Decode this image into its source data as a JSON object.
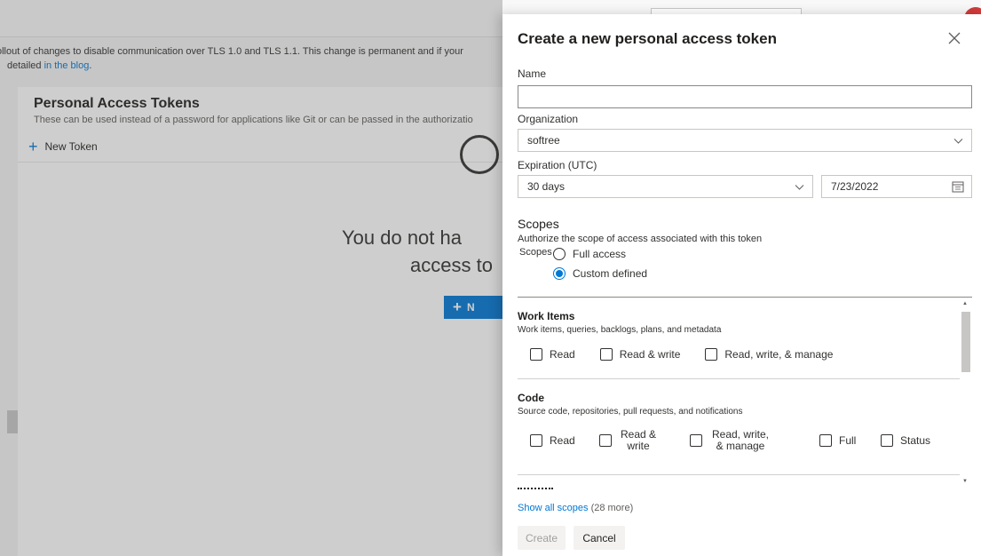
{
  "background": {
    "banner": {
      "line1": "ollout of changes to disable communication over TLS 1.0 and TLS 1.1. This change is permanent and if your",
      "line2_prefix": "detailed ",
      "line2_link": "in the blog",
      "line2_suffix": "."
    },
    "card": {
      "title": "Personal Access Tokens",
      "description": "These can be used instead of a password for applications like Git or can be passed in the authorizatio",
      "new_token_label": "New Token",
      "empty_line1": "You do not ha",
      "empty_line2": "access to",
      "new_button_label": "N"
    }
  },
  "panel": {
    "title": "Create a new personal access token",
    "name": {
      "label": "Name",
      "value": ""
    },
    "organization": {
      "label": "Organization",
      "selected": "softree"
    },
    "expiration": {
      "label": "Expiration (UTC)",
      "selected": "30 days",
      "date": "7/23/2022"
    },
    "scopes": {
      "title": "Scopes",
      "description": "Authorize the scope of access associated with this token",
      "radio_group_label": "Scopes",
      "options": [
        {
          "label": "Full access",
          "checked": false
        },
        {
          "label": "Custom defined",
          "checked": true
        }
      ],
      "sections": [
        {
          "name": "Work Items",
          "description": "Work items, queries, backlogs, plans, and metadata",
          "permissions": [
            "Read",
            "Read & write",
            "Read, write, & manage"
          ]
        },
        {
          "name": "Code",
          "description": "Source code, repositories, pull requests, and notifications",
          "permissions": [
            "Read",
            "Read & write",
            "Read, write, & manage",
            "Full",
            "Status"
          ]
        }
      ]
    },
    "show_all": {
      "link": "Show all scopes",
      "count": "(28 more)"
    },
    "buttons": {
      "create": "Create",
      "cancel": "Cancel"
    }
  },
  "colors": {
    "accent": "#0078d4",
    "disabled_text": "#a19f9d"
  }
}
